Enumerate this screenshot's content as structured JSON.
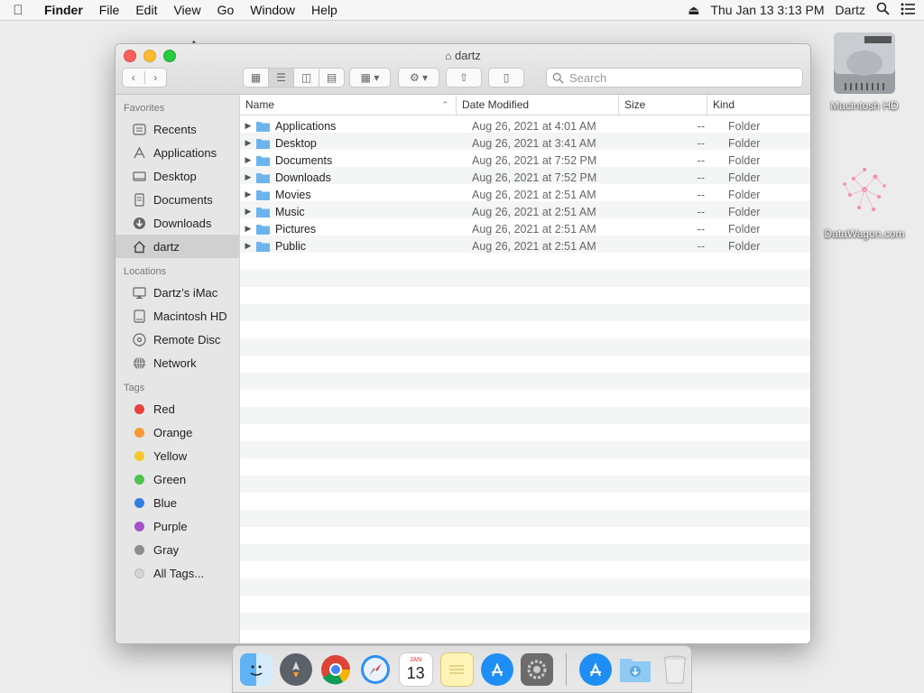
{
  "menubar": {
    "app": "Finder",
    "items": [
      "File",
      "Edit",
      "View",
      "Go",
      "Window",
      "Help"
    ],
    "datetime": "Thu Jan 13  3:13 PM",
    "user": "Dartz"
  },
  "desktop": {
    "icons": [
      {
        "label": "Macintosh HD",
        "icon": "hard-drive-icon"
      },
      {
        "label": "DataWagon.com",
        "icon": "image-file-icon"
      }
    ]
  },
  "window": {
    "title": "dartz",
    "search_placeholder": "Search",
    "sidebar": {
      "favorites_header": "Favorites",
      "favorites": [
        {
          "label": "Recents",
          "icon": "recents-icon"
        },
        {
          "label": "Applications",
          "icon": "applications-icon"
        },
        {
          "label": "Desktop",
          "icon": "desktop-icon"
        },
        {
          "label": "Documents",
          "icon": "documents-icon"
        },
        {
          "label": "Downloads",
          "icon": "downloads-icon"
        },
        {
          "label": "dartz",
          "icon": "home-icon",
          "selected": true
        }
      ],
      "locations_header": "Locations",
      "locations": [
        {
          "label": "Dartz’s iMac",
          "icon": "imac-icon"
        },
        {
          "label": "Macintosh HD",
          "icon": "hard-drive-icon"
        },
        {
          "label": "Remote Disc",
          "icon": "disc-icon"
        },
        {
          "label": "Network",
          "icon": "network-icon"
        }
      ],
      "tags_header": "Tags",
      "tags": [
        {
          "label": "Red",
          "color": "#e8413c"
        },
        {
          "label": "Orange",
          "color": "#f39a33"
        },
        {
          "label": "Yellow",
          "color": "#f5c92c"
        },
        {
          "label": "Green",
          "color": "#4cc34a"
        },
        {
          "label": "Blue",
          "color": "#2f7fe3"
        },
        {
          "label": "Purple",
          "color": "#a552c8"
        },
        {
          "label": "Gray",
          "color": "#8e8e8e"
        },
        {
          "label": "All Tags...",
          "color": "#d4d4d4"
        }
      ]
    },
    "columns": {
      "name": "Name",
      "date": "Date Modified",
      "size": "Size",
      "kind": "Kind"
    },
    "rows": [
      {
        "name": "Applications",
        "date": "Aug 26, 2021 at 4:01 AM",
        "size": "--",
        "kind": "Folder"
      },
      {
        "name": "Desktop",
        "date": "Aug 26, 2021 at 3:41 AM",
        "size": "--",
        "kind": "Folder"
      },
      {
        "name": "Documents",
        "date": "Aug 26, 2021 at 7:52 PM",
        "size": "--",
        "kind": "Folder"
      },
      {
        "name": "Downloads",
        "date": "Aug 26, 2021 at 7:52 PM",
        "size": "--",
        "kind": "Folder"
      },
      {
        "name": "Movies",
        "date": "Aug 26, 2021 at 2:51 AM",
        "size": "--",
        "kind": "Folder"
      },
      {
        "name": "Music",
        "date": "Aug 26, 2021 at 2:51 AM",
        "size": "--",
        "kind": "Folder"
      },
      {
        "name": "Pictures",
        "date": "Aug 26, 2021 at 2:51 AM",
        "size": "--",
        "kind": "Folder"
      },
      {
        "name": "Public",
        "date": "Aug 26, 2021 at 2:51 AM",
        "size": "--",
        "kind": "Folder"
      }
    ]
  },
  "dock": {
    "calendar_month": "JAN",
    "calendar_day": "13",
    "apps": [
      "finder-icon",
      "launchpad-icon",
      "chrome-icon",
      "safari-icon",
      "calendar-icon",
      "notes-icon",
      "app-store-icon",
      "system-preferences-icon"
    ],
    "right": [
      "app-store-download-icon",
      "downloads-folder-icon",
      "trash-icon"
    ]
  },
  "colors": {
    "accent": "#3a8ee6",
    "folder": "#6cb4ee",
    "selected_sidebar": "#d0d0d0"
  }
}
